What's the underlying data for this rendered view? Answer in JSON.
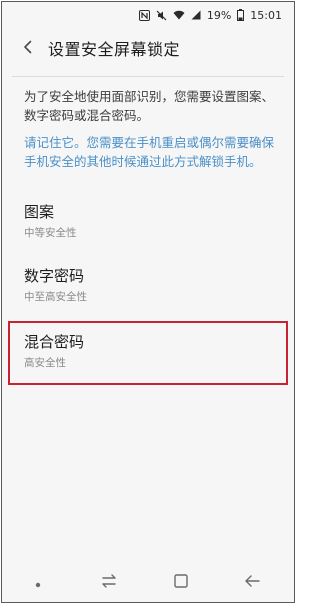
{
  "status_bar": {
    "icons": [
      "nfc-icon",
      "mute-icon",
      "wifi-icon",
      "signal-icon",
      "battery-icon"
    ],
    "battery": "19%",
    "time": "15:01"
  },
  "header": {
    "title": "设置安全屏幕锁定"
  },
  "description": "为了安全地使用面部识别，您需要设置图案、数字密码或混合密码。",
  "notice": "请记住它。您需要在手机重启或偶尔需要确保手机安全的其他时候通过此方式解锁手机。",
  "options": [
    {
      "label": "图案",
      "subtitle": "中等安全性"
    },
    {
      "label": "数字密码",
      "subtitle": "中至高安全性"
    },
    {
      "label": "混合密码",
      "subtitle": "高安全性"
    }
  ],
  "navigation": [
    "dot-icon",
    "recent-apps-icon",
    "home-icon",
    "back-icon"
  ],
  "colors": {
    "accent": "#4a90c8",
    "highlight_border": "#c82333",
    "background": "#f6f6f6"
  }
}
